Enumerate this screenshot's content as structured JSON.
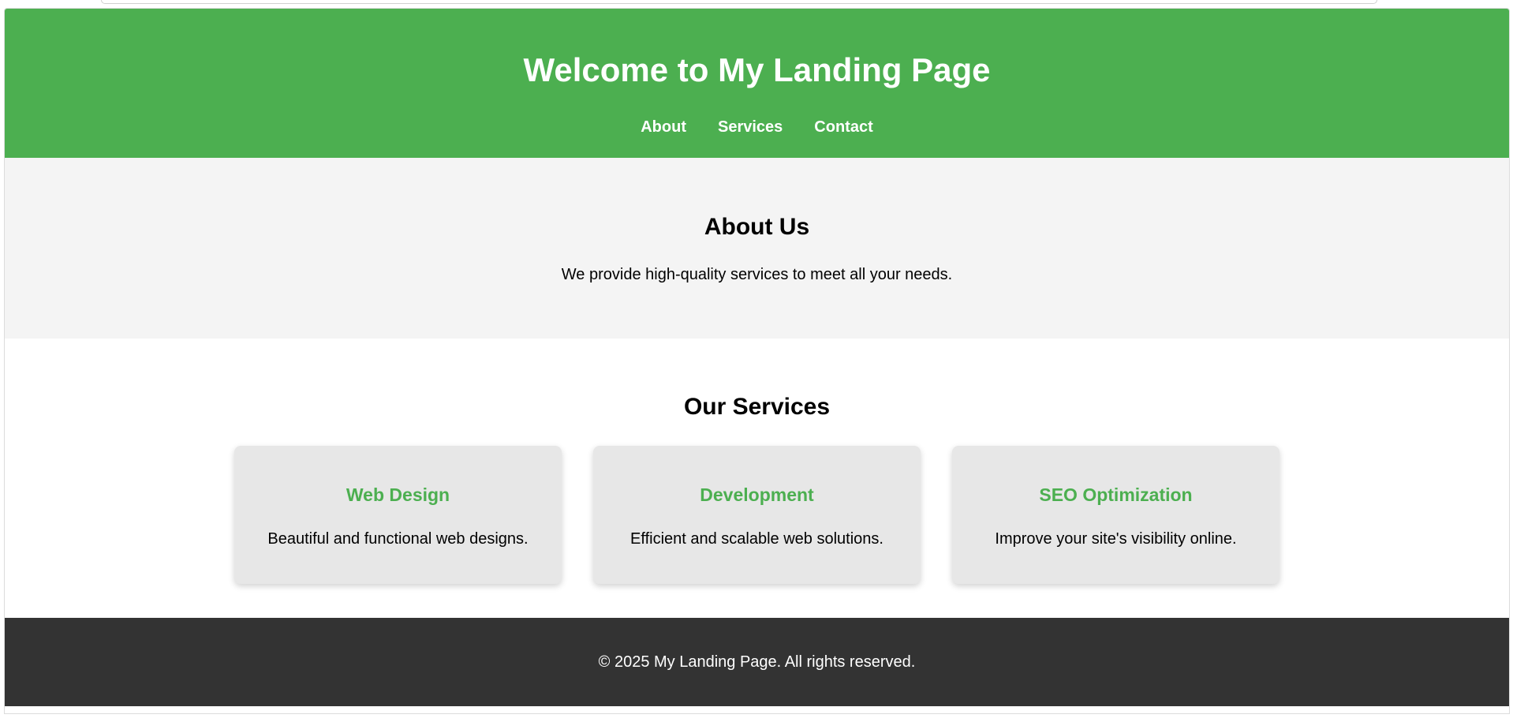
{
  "header": {
    "title": "Welcome to My Landing Page",
    "nav": [
      {
        "label": "About"
      },
      {
        "label": "Services"
      },
      {
        "label": "Contact"
      }
    ]
  },
  "about": {
    "heading": "About Us",
    "text": "We provide high-quality services to meet all your needs."
  },
  "services": {
    "heading": "Our Services",
    "cards": [
      {
        "title": "Web Design",
        "text": "Beautiful and functional web designs."
      },
      {
        "title": "Development",
        "text": "Efficient and scalable web solutions."
      },
      {
        "title": "SEO Optimization",
        "text": "Improve your site's visibility online."
      }
    ]
  },
  "footer": {
    "text": "© 2025 My Landing Page. All rights reserved."
  },
  "colors": {
    "header_bg": "#4caf50",
    "accent": "#4caf50",
    "about_bg": "#f4f4f4",
    "card_bg": "#e7e7e7",
    "footer_bg": "#333333"
  }
}
